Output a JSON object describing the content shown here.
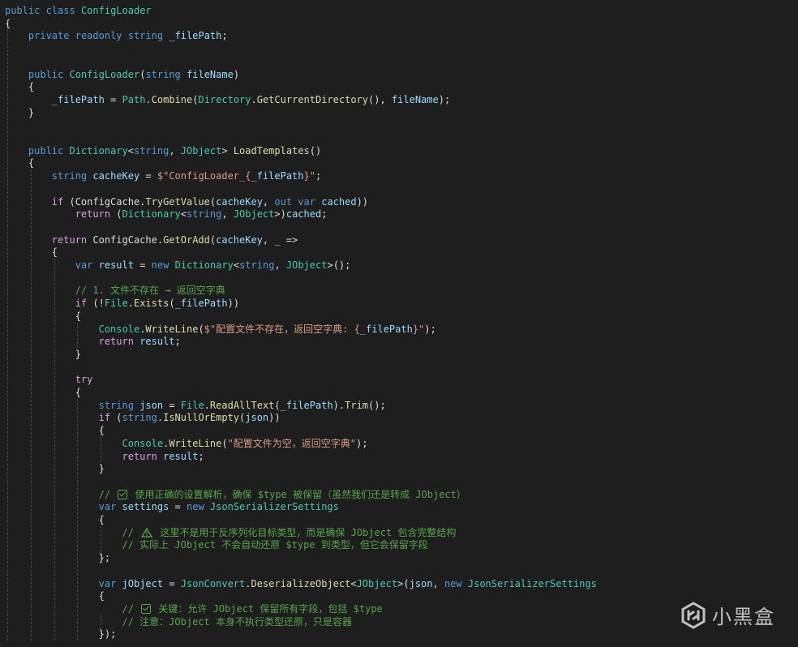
{
  "theme": {
    "background": "#1e1e1e",
    "keyword": "#569cd6",
    "control": "#d8a0df",
    "type": "#4ec9b0",
    "method": "#dcdcaa",
    "variable": "#9cdcfe",
    "string": "#d69d85",
    "comment": "#57a64a",
    "plain": "#dcdcdc"
  },
  "code": {
    "lines": [
      {
        "tokens": [
          [
            "kw",
            "public"
          ],
          [
            "pl",
            " "
          ],
          [
            "kw",
            "class"
          ],
          [
            "pl",
            " "
          ],
          [
            "ty",
            "ConfigLoader"
          ]
        ]
      },
      {
        "tokens": [
          [
            "pl",
            "{"
          ]
        ]
      },
      {
        "tokens": [
          [
            "pl",
            "    "
          ],
          [
            "kw",
            "private"
          ],
          [
            "pl",
            " "
          ],
          [
            "kw",
            "readonly"
          ],
          [
            "pl",
            " "
          ],
          [
            "kw",
            "string"
          ],
          [
            "pl",
            " "
          ],
          [
            "va",
            "_filePath"
          ],
          [
            "pl",
            ";"
          ]
        ]
      },
      {
        "tokens": []
      },
      {
        "tokens": []
      },
      {
        "tokens": [
          [
            "pl",
            "    "
          ],
          [
            "kw",
            "public"
          ],
          [
            "pl",
            " "
          ],
          [
            "ty",
            "ConfigLoader"
          ],
          [
            "pl",
            "("
          ],
          [
            "kw",
            "string"
          ],
          [
            "pl",
            " "
          ],
          [
            "va",
            "fileName"
          ],
          [
            "pl",
            ")"
          ]
        ]
      },
      {
        "tokens": [
          [
            "pl",
            "    {"
          ]
        ]
      },
      {
        "tokens": [
          [
            "pl",
            "        "
          ],
          [
            "va",
            "_filePath"
          ],
          [
            "pl",
            " = "
          ],
          [
            "ty",
            "Path"
          ],
          [
            "pl",
            "."
          ],
          [
            "me",
            "Combine"
          ],
          [
            "pl",
            "("
          ],
          [
            "ty",
            "Directory"
          ],
          [
            "pl",
            "."
          ],
          [
            "me",
            "GetCurrentDirectory"
          ],
          [
            "pl",
            "(), "
          ],
          [
            "va",
            "fileName"
          ],
          [
            "pl",
            ");"
          ]
        ]
      },
      {
        "tokens": [
          [
            "pl",
            "    }"
          ]
        ]
      },
      {
        "tokens": []
      },
      {
        "tokens": []
      },
      {
        "tokens": [
          [
            "pl",
            "    "
          ],
          [
            "kw",
            "public"
          ],
          [
            "pl",
            " "
          ],
          [
            "ty",
            "Dictionary"
          ],
          [
            "pl",
            "<"
          ],
          [
            "kw",
            "string"
          ],
          [
            "pl",
            ", "
          ],
          [
            "ty",
            "JObject"
          ],
          [
            "pl",
            "> "
          ],
          [
            "me",
            "LoadTemplates"
          ],
          [
            "pl",
            "()"
          ]
        ]
      },
      {
        "tokens": [
          [
            "pl",
            "    {"
          ]
        ]
      },
      {
        "tokens": [
          [
            "pl",
            "        "
          ],
          [
            "kw",
            "string"
          ],
          [
            "pl",
            " "
          ],
          [
            "va",
            "cacheKey"
          ],
          [
            "pl",
            " = "
          ],
          [
            "st",
            "$\"ConfigLoader_{"
          ],
          [
            "va",
            "_filePath"
          ],
          [
            "st",
            "}\""
          ],
          [
            "pl",
            ";"
          ]
        ]
      },
      {
        "tokens": []
      },
      {
        "tokens": [
          [
            "pl",
            "        "
          ],
          [
            "ct",
            "if"
          ],
          [
            "pl",
            " (ConfigCache."
          ],
          [
            "me",
            "TryGetValue"
          ],
          [
            "pl",
            "("
          ],
          [
            "va",
            "cacheKey"
          ],
          [
            "pl",
            ", "
          ],
          [
            "kw",
            "out"
          ],
          [
            "pl",
            " "
          ],
          [
            "kw",
            "var"
          ],
          [
            "pl",
            " "
          ],
          [
            "va",
            "cached"
          ],
          [
            "pl",
            "))"
          ]
        ]
      },
      {
        "tokens": [
          [
            "pl",
            "            "
          ],
          [
            "ct",
            "return"
          ],
          [
            "pl",
            " ("
          ],
          [
            "ty",
            "Dictionary"
          ],
          [
            "pl",
            "<"
          ],
          [
            "kw",
            "string"
          ],
          [
            "pl",
            ", "
          ],
          [
            "ty",
            "JObject"
          ],
          [
            "pl",
            ">)"
          ],
          [
            "va",
            "cached"
          ],
          [
            "pl",
            ";"
          ]
        ]
      },
      {
        "tokens": []
      },
      {
        "tokens": [
          [
            "pl",
            "        "
          ],
          [
            "ct",
            "return"
          ],
          [
            "pl",
            " ConfigCache."
          ],
          [
            "me",
            "GetOrAdd"
          ],
          [
            "pl",
            "("
          ],
          [
            "va",
            "cacheKey"
          ],
          [
            "pl",
            ", _ =>"
          ]
        ]
      },
      {
        "tokens": [
          [
            "pl",
            "        {"
          ]
        ]
      },
      {
        "tokens": [
          [
            "pl",
            "            "
          ],
          [
            "kw",
            "var"
          ],
          [
            "pl",
            " "
          ],
          [
            "va",
            "result"
          ],
          [
            "pl",
            " = "
          ],
          [
            "kw",
            "new"
          ],
          [
            "pl",
            " "
          ],
          [
            "ty",
            "Dictionary"
          ],
          [
            "pl",
            "<"
          ],
          [
            "kw",
            "string"
          ],
          [
            "pl",
            ", "
          ],
          [
            "ty",
            "JObject"
          ],
          [
            "pl",
            ">();"
          ]
        ]
      },
      {
        "tokens": []
      },
      {
        "tokens": [
          [
            "pl",
            "            "
          ],
          [
            "cm",
            "// 1. 文件不存在 → 返回空字典"
          ]
        ]
      },
      {
        "tokens": [
          [
            "pl",
            "            "
          ],
          [
            "ct",
            "if"
          ],
          [
            "pl",
            " (!"
          ],
          [
            "ty",
            "File"
          ],
          [
            "pl",
            "."
          ],
          [
            "me",
            "Exists"
          ],
          [
            "pl",
            "("
          ],
          [
            "va",
            "_filePath"
          ],
          [
            "pl",
            "))"
          ]
        ]
      },
      {
        "tokens": [
          [
            "pl",
            "            {"
          ]
        ]
      },
      {
        "tokens": [
          [
            "pl",
            "                "
          ],
          [
            "ty",
            "Console"
          ],
          [
            "pl",
            "."
          ],
          [
            "me",
            "WriteLine"
          ],
          [
            "pl",
            "("
          ],
          [
            "st",
            "$\"配置文件不存在，返回空字典: {"
          ],
          [
            "va",
            "_filePath"
          ],
          [
            "st",
            "}\""
          ],
          [
            "pl",
            ");"
          ]
        ]
      },
      {
        "tokens": [
          [
            "pl",
            "                "
          ],
          [
            "ct",
            "return"
          ],
          [
            "pl",
            " "
          ],
          [
            "va",
            "result"
          ],
          [
            "pl",
            ";"
          ]
        ]
      },
      {
        "tokens": [
          [
            "pl",
            "            }"
          ]
        ]
      },
      {
        "tokens": []
      },
      {
        "tokens": [
          [
            "pl",
            "            "
          ],
          [
            "ct",
            "try"
          ]
        ]
      },
      {
        "tokens": [
          [
            "pl",
            "            {"
          ]
        ]
      },
      {
        "tokens": [
          [
            "pl",
            "                "
          ],
          [
            "kw",
            "string"
          ],
          [
            "pl",
            " "
          ],
          [
            "va",
            "json"
          ],
          [
            "pl",
            " = "
          ],
          [
            "ty",
            "File"
          ],
          [
            "pl",
            "."
          ],
          [
            "me",
            "ReadAllText"
          ],
          [
            "pl",
            "("
          ],
          [
            "va",
            "_filePath"
          ],
          [
            "pl",
            ")."
          ],
          [
            "me",
            "Trim"
          ],
          [
            "pl",
            "();"
          ]
        ]
      },
      {
        "tokens": [
          [
            "pl",
            "                "
          ],
          [
            "ct",
            "if"
          ],
          [
            "pl",
            " ("
          ],
          [
            "kw",
            "string"
          ],
          [
            "pl",
            "."
          ],
          [
            "me",
            "IsNullOrEmpty"
          ],
          [
            "pl",
            "("
          ],
          [
            "va",
            "json"
          ],
          [
            "pl",
            "))"
          ]
        ]
      },
      {
        "tokens": [
          [
            "pl",
            "                {"
          ]
        ]
      },
      {
        "tokens": [
          [
            "pl",
            "                    "
          ],
          [
            "ty",
            "Console"
          ],
          [
            "pl",
            "."
          ],
          [
            "me",
            "WriteLine"
          ],
          [
            "pl",
            "("
          ],
          [
            "st",
            "\"配置文件为空，返回空字典\""
          ],
          [
            "pl",
            ");"
          ]
        ]
      },
      {
        "tokens": [
          [
            "pl",
            "                    "
          ],
          [
            "ct",
            "return"
          ],
          [
            "pl",
            " "
          ],
          [
            "va",
            "result"
          ],
          [
            "pl",
            ";"
          ]
        ]
      },
      {
        "tokens": [
          [
            "pl",
            "                }"
          ]
        ]
      },
      {
        "tokens": []
      },
      {
        "tokens": [
          [
            "pl",
            "                "
          ],
          [
            "cm",
            "// "
          ],
          [
            "cb",
            ""
          ],
          [
            "cm",
            " 使用正确的设置解析，确保 $type 被保留（虽然我们还是转成 JObject）"
          ]
        ]
      },
      {
        "tokens": [
          [
            "pl",
            "                "
          ],
          [
            "kw",
            "var"
          ],
          [
            "pl",
            " "
          ],
          [
            "va",
            "settings"
          ],
          [
            "pl",
            " = "
          ],
          [
            "kw",
            "new"
          ],
          [
            "pl",
            " "
          ],
          [
            "ty",
            "JsonSerializerSettings"
          ]
        ]
      },
      {
        "tokens": [
          [
            "pl",
            "                {"
          ]
        ]
      },
      {
        "tokens": [
          [
            "pl",
            "                    "
          ],
          [
            "cm",
            "// "
          ],
          [
            "wn",
            ""
          ],
          [
            "cm",
            " 这里不是用于反序列化目标类型，而是确保 JObject 包含完整结构"
          ]
        ]
      },
      {
        "tokens": [
          [
            "pl",
            "                    "
          ],
          [
            "cm",
            "// 实际上 JObject 不会自动还原 $type 到类型，但它会保留字段"
          ]
        ]
      },
      {
        "tokens": [
          [
            "pl",
            "                };"
          ]
        ]
      },
      {
        "tokens": []
      },
      {
        "tokens": [
          [
            "pl",
            "                "
          ],
          [
            "kw",
            "var"
          ],
          [
            "pl",
            " "
          ],
          [
            "va",
            "jObject"
          ],
          [
            "pl",
            " = "
          ],
          [
            "ty",
            "JsonConvert"
          ],
          [
            "pl",
            "."
          ],
          [
            "me",
            "DeserializeObject"
          ],
          [
            "pl",
            "<"
          ],
          [
            "ty",
            "JObject"
          ],
          [
            "pl",
            ">("
          ],
          [
            "va",
            "json"
          ],
          [
            "pl",
            ", "
          ],
          [
            "kw",
            "new"
          ],
          [
            "pl",
            " "
          ],
          [
            "ty",
            "JsonSerializerSettings"
          ]
        ]
      },
      {
        "tokens": [
          [
            "pl",
            "                {"
          ]
        ]
      },
      {
        "tokens": [
          [
            "pl",
            "                    "
          ],
          [
            "cm",
            "// "
          ],
          [
            "cb",
            ""
          ],
          [
            "cm",
            " 关键：允许 JObject 保留所有字段，包括 $type"
          ]
        ]
      },
      {
        "tokens": [
          [
            "pl",
            "                    "
          ],
          [
            "cm",
            "// 注意：JObject 本身不执行类型还原，只是容器"
          ]
        ]
      },
      {
        "tokens": [
          [
            "pl",
            "                });"
          ]
        ]
      }
    ]
  },
  "watermark": {
    "logo": "xiaoheihe-logo",
    "text": "小黑盒"
  }
}
